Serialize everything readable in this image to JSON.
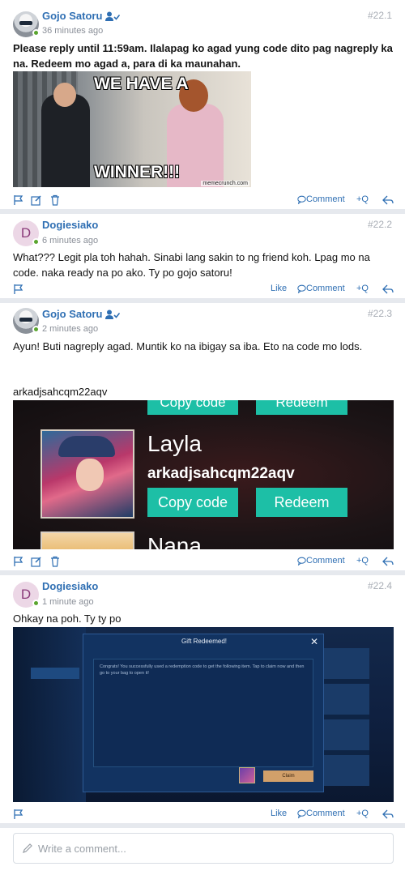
{
  "posts": [
    {
      "author": "Gojo Satoru",
      "time": "36 minutes ago",
      "number": "#22.1",
      "text": "Please reply until 11:59am. Ilalapag ko agad yung code dito pag nagreply ka na. Redeem mo agad a, para di ka maunahan.",
      "image": {
        "caption_top": "WE HAVE A",
        "caption_bottom": "WINNER!!!",
        "watermark": "memecrunch.com"
      },
      "comment_label": "Comment",
      "quote_label": "+Q"
    },
    {
      "author": "Dogiesiako",
      "avatar_letter": "D",
      "time": "6 minutes ago",
      "number": "#22.2",
      "text": "What??? Legit pla toh hahah. Sinabi lang sakin to ng friend koh. Lpag mo na code. naka ready na po ako. Ty po gojo satoru!",
      "like_label": "Like",
      "comment_label": "Comment",
      "quote_label": "+Q"
    },
    {
      "author": "Gojo Satoru",
      "time": "2 minutes ago",
      "number": "#22.3",
      "text": "Ayun! Buti nagreply agad. Muntik ko na ibigay sa iba. Eto na code mo lods.",
      "code_text": "arkadjsahcqm22aqv",
      "image": {
        "top_copy": "Copy code",
        "top_redeem": "Redeem",
        "hero_name": "Layla",
        "hero_code": "arkadjsahcqm22aqv",
        "copy_label": "Copy code",
        "redeem_label": "Redeem",
        "next_hero": "Nana"
      },
      "comment_label": "Comment",
      "quote_label": "+Q"
    },
    {
      "author": "Dogiesiako",
      "avatar_letter": "D",
      "time": "1 minute ago",
      "number": "#22.4",
      "text": "Ohkay na poh. Ty ty po",
      "image": {
        "dialog_title": "Gift Redeemed!",
        "dialog_message": "Congrats! You successfully used a redemption code to get the following item. Tap to claim now and then go to your bag to open it!",
        "claim_label": "Claim"
      },
      "like_label": "Like",
      "comment_label": "Comment",
      "quote_label": "+Q"
    }
  ],
  "comment_input": {
    "placeholder": "Write a comment..."
  },
  "colors": {
    "link": "#2f6fb3",
    "muted": "#8a8f98",
    "online": "#5aa52e",
    "accent_teal": "#1dbfa6"
  }
}
